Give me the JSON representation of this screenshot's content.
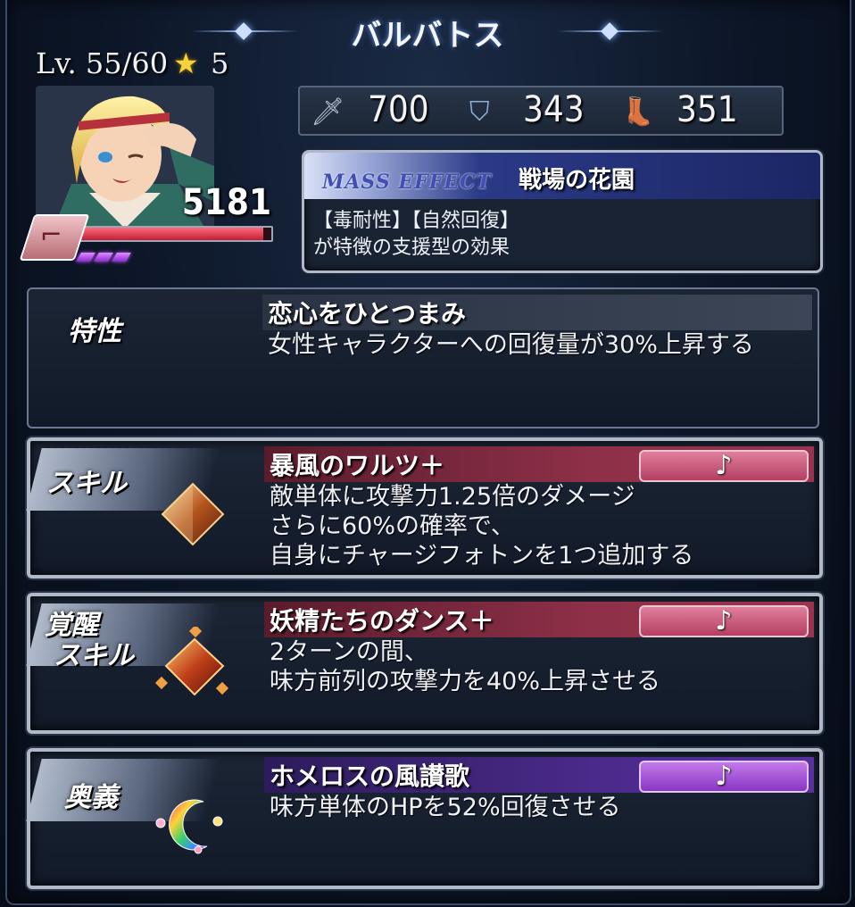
{
  "header": {
    "title": "バルバトス"
  },
  "unit": {
    "level_text": "Lv. 55/60",
    "rarity": "5",
    "hp": "5181",
    "hp_fill": 0.96,
    "pips": 3
  },
  "stats": {
    "attack": "700",
    "defense": "343",
    "speed": "351"
  },
  "mass_effect": {
    "tag": "MASS EFFECT",
    "name": "戦場の花園",
    "desc": [
      "【毒耐性】【自然回復】",
      "が特徴の支援型の効果"
    ]
  },
  "trait": {
    "label": "特性",
    "name": "恋心をひとつまみ",
    "desc": [
      "女性キャラクターへの回復量が30%上昇する"
    ]
  },
  "skill": {
    "label": "スキル",
    "name": "暴風のワルツ＋",
    "note": "♪",
    "desc": [
      "敵単体に攻撃力1.25倍のダメージ",
      "さらに60%の確率で、",
      "自身にチャージフォトンを1つ追加する"
    ]
  },
  "awakened_skill": {
    "label_line1": "覚醒",
    "label_line2": "スキル",
    "name": "妖精たちのダンス＋",
    "note": "♪",
    "desc": [
      "2ターンの間、",
      "味方前列の攻撃力を40%上昇させる"
    ]
  },
  "ougi": {
    "label": "奥義",
    "name": "ホメロスの風讃歌",
    "note": "♪",
    "desc": [
      "味方単体のHPを52%回復させる"
    ]
  },
  "colors": {
    "skill_accent": "#9a3350",
    "ougi_accent": "#5a2f9e",
    "hp_bar": "#c21e36",
    "star": "#f6d23c"
  },
  "icons": [
    "star-icon",
    "sword-icon",
    "shield-icon",
    "boot-icon",
    "rifle-icon",
    "gem-icon",
    "gem-cluster-icon",
    "crescent-orb-icon",
    "music-note-icon"
  ]
}
